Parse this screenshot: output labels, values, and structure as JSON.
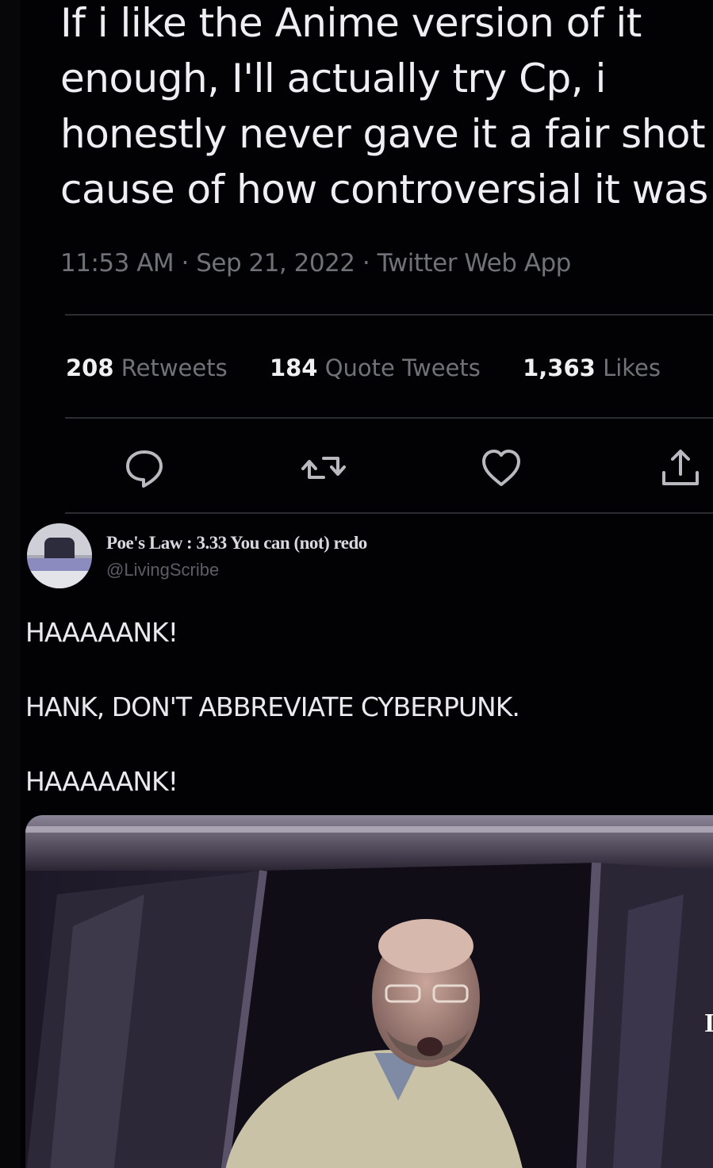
{
  "tweet": {
    "text_lines": [
      "If i like the Anime version of it",
      "enough, I'll actually try Cp, i",
      "honestly never gave it a fair shot",
      "cause of how controversial it was"
    ],
    "timestamp": "11:53 AM · Sep 21, 2022 · Twitter Web App",
    "stats": [
      {
        "count": "208",
        "label": "Retweets"
      },
      {
        "count": "184",
        "label": "Quote Tweets"
      },
      {
        "count": "1,363",
        "label": "Likes"
      }
    ],
    "actions": [
      "reply-icon",
      "retweet-icon",
      "like-icon",
      "share-icon"
    ]
  },
  "reply": {
    "display_name": "Poe's Law : 3.33 You can (not) redo",
    "handle": "@LivingScribe",
    "lines": [
      "HAAAAANK!",
      "HANK, DON'T ABBREVIATE CYBERPUNK.",
      "HAAAAANK!"
    ]
  },
  "colors": {
    "background": "#020104",
    "text": "#efeff3",
    "muted": "#6f7378",
    "divider": "#2b2d31"
  }
}
